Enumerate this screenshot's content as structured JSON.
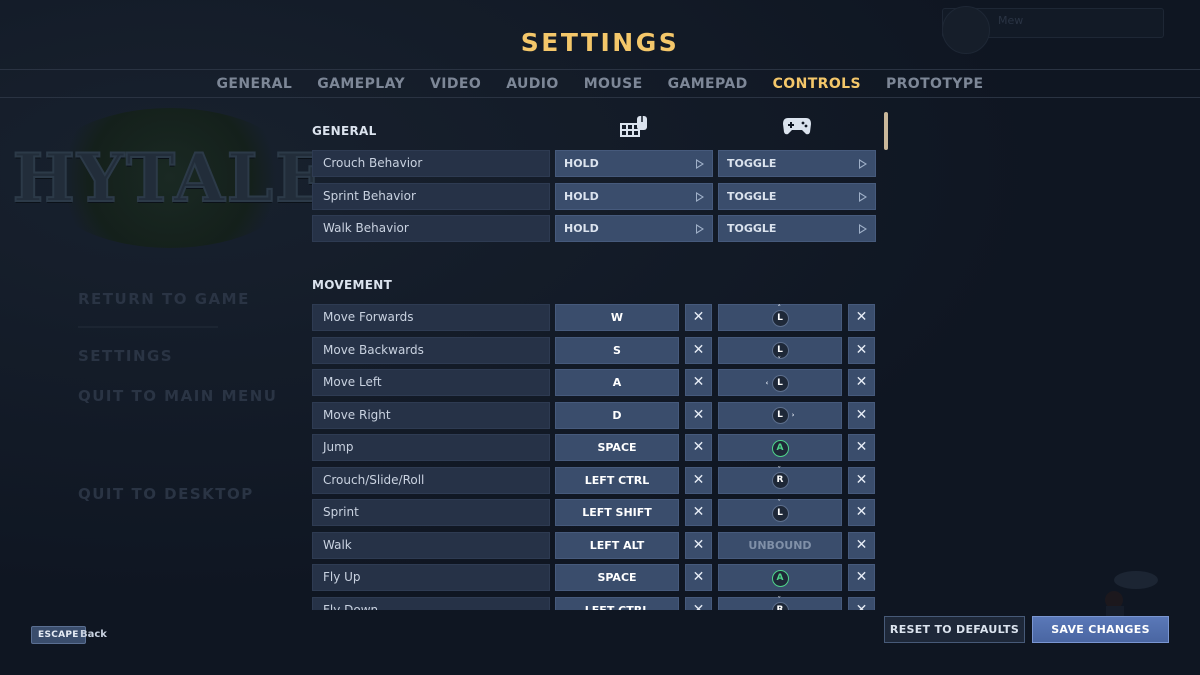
{
  "header": {
    "title": "SETTINGS"
  },
  "tabs": [
    {
      "label": "GENERAL",
      "active": false
    },
    {
      "label": "GAMEPLAY",
      "active": false
    },
    {
      "label": "VIDEO",
      "active": false
    },
    {
      "label": "AUDIO",
      "active": false
    },
    {
      "label": "MOUSE",
      "active": false
    },
    {
      "label": "GAMEPAD",
      "active": false
    },
    {
      "label": "CONTROLS",
      "active": true
    },
    {
      "label": "PROTOTYPE",
      "active": false
    }
  ],
  "background": {
    "logo_text": "HYTALE",
    "menu": {
      "return": "RETURN TO GAME",
      "settings": "SETTINGS",
      "quit_main": "QUIT TO MAIN MENU",
      "quit_desktop": "QUIT TO DESKTOP"
    },
    "user_name": "Mew"
  },
  "controls": {
    "general": {
      "title": "GENERAL",
      "keyboard_icon": "keyboard-mouse-icon",
      "gamepad_icon": "gamepad-icon",
      "rows": [
        {
          "label": "Crouch Behavior",
          "keyboard": "HOLD",
          "gamepad": "TOGGLE"
        },
        {
          "label": "Sprint Behavior",
          "keyboard": "HOLD",
          "gamepad": "TOGGLE"
        },
        {
          "label": "Walk Behavior",
          "keyboard": "HOLD",
          "gamepad": "TOGGLE"
        }
      ]
    },
    "movement": {
      "title": "MOVEMENT",
      "unbound_label": "UNBOUND",
      "rows": [
        {
          "label": "Move Forwards",
          "key": "W",
          "pad": "L",
          "pad_dir": "up"
        },
        {
          "label": "Move Backwards",
          "key": "S",
          "pad": "L",
          "pad_dir": "down"
        },
        {
          "label": "Move Left",
          "key": "A",
          "pad": "L",
          "pad_dir": "left"
        },
        {
          "label": "Move Right",
          "key": "D",
          "pad": "L",
          "pad_dir": "right"
        },
        {
          "label": "Jump",
          "key": "SPACE",
          "pad": "A",
          "pad_dir": "none"
        },
        {
          "label": "Crouch/Slide/Roll",
          "key": "LEFT CTRL",
          "pad": "R",
          "pad_dir": "press"
        },
        {
          "label": "Sprint",
          "key": "LEFT SHIFT",
          "pad": "L",
          "pad_dir": "press"
        },
        {
          "label": "Walk",
          "key": "LEFT ALT",
          "pad": "UNBOUND",
          "pad_dir": "none"
        },
        {
          "label": "Fly Up",
          "key": "SPACE",
          "pad": "A",
          "pad_dir": "none"
        },
        {
          "label": "Fly Down",
          "key": "LEFT CTRL",
          "pad": "R",
          "pad_dir": "press"
        }
      ]
    }
  },
  "footer": {
    "escape_key": "ESCAPE",
    "escape_label": "Back",
    "reset_label": "RESET TO DEFAULTS",
    "save_label": "SAVE CHANGES"
  },
  "colors": {
    "accent": "#f4c76a",
    "background": "#0f1622",
    "button": "#3a4d6c",
    "label_bg": "#263247",
    "save": "#4a66a2",
    "glyph_green": "#4ed38a"
  }
}
